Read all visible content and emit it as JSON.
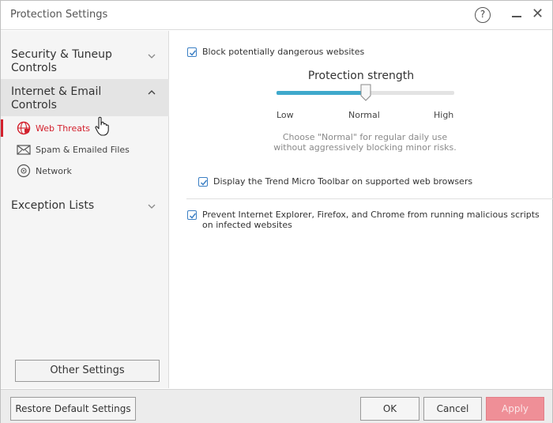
{
  "window": {
    "title": "Protection Settings",
    "help_label": "?",
    "close_label": "✕"
  },
  "sidebar": {
    "groups": [
      {
        "label_line1": "Security & Tuneup",
        "label_line2": "Controls"
      },
      {
        "label_line1": "Internet & Email",
        "label_line2": "Controls"
      },
      {
        "label_line1": "Exception Lists"
      }
    ],
    "subitems": [
      {
        "label": "Web Threats",
        "icon": "globe-shield-icon"
      },
      {
        "label": "Spam & Emailed Files",
        "icon": "mail-icon"
      },
      {
        "label": "Network",
        "icon": "network-icon"
      }
    ],
    "other_settings_label": "Other Settings"
  },
  "main": {
    "block_sites": {
      "label": "Block potentially dangerous websites",
      "checked": true
    },
    "strength": {
      "title": "Protection strength",
      "low": "Low",
      "normal": "Normal",
      "high": "High",
      "level": 0.5,
      "hint_line1": "Choose \"Normal\" for regular daily use",
      "hint_line2": "without aggressively blocking minor risks."
    },
    "toolbar": {
      "label": "Display the Trend Micro Toolbar on supported web browsers",
      "checked": true
    },
    "scripts": {
      "label_line1": "Prevent Internet Explorer, Firefox, and Chrome from running malicious scripts",
      "label_line2": "on infected websites",
      "checked": true
    }
  },
  "footer": {
    "restore_label": "Restore Default Settings",
    "ok_label": "OK",
    "cancel_label": "Cancel",
    "apply_label": "Apply"
  },
  "colors": {
    "accent_red": "#d3212d",
    "slider_blue": "#3fa9cc",
    "checkbox_blue": "#3b7fc4",
    "apply_disabled": "#ef8f97"
  }
}
